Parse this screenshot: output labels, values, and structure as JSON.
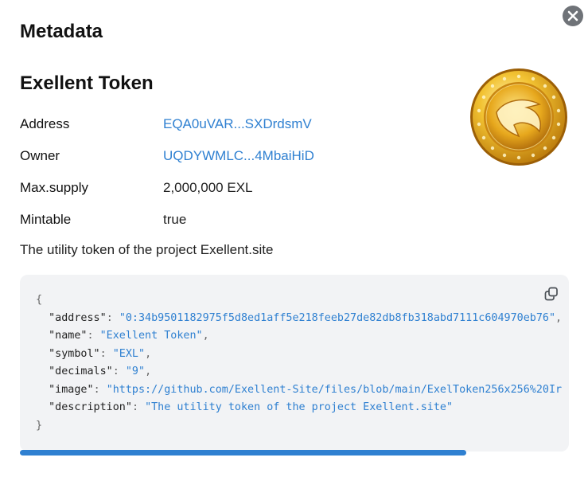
{
  "modal": {
    "title": "Metadata",
    "close_icon": "close-icon"
  },
  "token": {
    "name": "Exellent Token",
    "properties": [
      {
        "key": "Address",
        "value": "EQA0uVAR...SXDrdsmV",
        "is_link": true
      },
      {
        "key": "Owner",
        "value": "UQDYWMLC...4MbaiHiD",
        "is_link": true
      },
      {
        "key": "Max.supply",
        "value": "2,000,000 EXL",
        "is_link": false
      },
      {
        "key": "Mintable",
        "value": "true",
        "is_link": false
      }
    ],
    "description": "The utility token of the project Exellent.site",
    "image_icon": "gold-coin-logo"
  },
  "json_view": {
    "open_brace": "{",
    "close_brace": "}",
    "copy_icon": "copy-icon",
    "fields": [
      {
        "key": "\"address\"",
        "value": "\"0:34b9501182975f5d8ed1aff5e218feeb27de82db8fb318abd7111c604970eb76\"",
        "comma": ","
      },
      {
        "key": "\"name\"",
        "value": "\"Exellent Token\"",
        "comma": ","
      },
      {
        "key": "\"symbol\"",
        "value": "\"EXL\"",
        "comma": ","
      },
      {
        "key": "\"decimals\"",
        "value": "\"9\"",
        "comma": ","
      },
      {
        "key": "\"image\"",
        "value": "\"https://github.com/Exellent-Site/files/blob/main/ExelToken256x256%20Ir",
        "comma": ""
      },
      {
        "key": "\"description\"",
        "value": "\"The utility token of the project Exellent.site\"",
        "comma": ""
      }
    ],
    "horizontal_scroll_fraction": 0.81
  },
  "colors": {
    "link": "#2f80d1",
    "code_bg": "#f2f3f5",
    "close_bg": "#6f7378",
    "coin_gold": "#e6a817"
  }
}
